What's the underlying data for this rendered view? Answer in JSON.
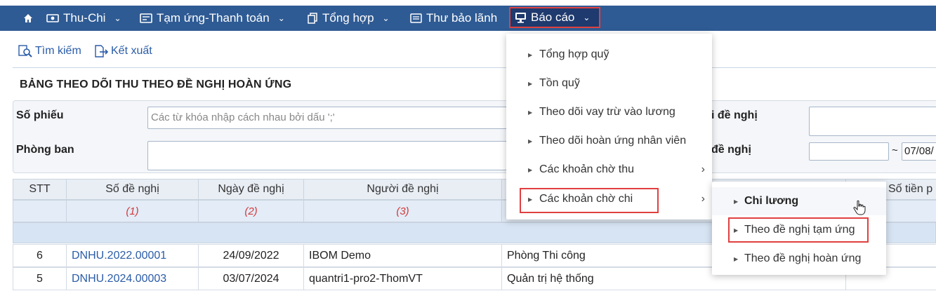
{
  "nav": {
    "items": [
      {
        "label": "Thu-Chi",
        "icon": "cash-icon"
      },
      {
        "label": "Tạm ứng-Thanh toán",
        "icon": "payment-icon"
      },
      {
        "label": "Tổng hợp",
        "icon": "copy-icon"
      },
      {
        "label": "Thư bảo lãnh",
        "icon": "letter-icon"
      },
      {
        "label": "Báo cáo",
        "icon": "monitor-icon"
      }
    ]
  },
  "toolbar": {
    "search_label": "Tìm kiếm",
    "export_label": "Kết xuất"
  },
  "page_title": "BẢNG THEO DÕI THU THEO ĐỀ NGHỊ HOÀN ỨNG",
  "filters": {
    "so_phieu_label": "Số phiếu",
    "so_phieu_placeholder": "Các từ khóa nhập cách nhau bởi dấu ';'",
    "phong_ban_label": "Phòng ban",
    "right_label_1": "i đề nghị",
    "right_label_2": "đề nghị",
    "date_sep": "~",
    "date_to": "07/08/"
  },
  "table": {
    "headers": [
      "STT",
      "Số đề nghị",
      "Ngày đề nghị",
      "Người đề nghị",
      "Số tiền p"
    ],
    "col_numbers": [
      "(1)",
      "(2)",
      "(3)"
    ],
    "rows": [
      {
        "stt": "6",
        "so": "DNHU.2022.00001",
        "ngay": "24/09/2022",
        "nguoi": "IBOM Demo",
        "phong": "Phòng Thi công"
      },
      {
        "stt": "5",
        "so": "DNHU.2024.00003",
        "ngay": "03/07/2024",
        "nguoi": "quantri1-pro2-ThomVT",
        "phong": "Quản trị hệ thống"
      }
    ]
  },
  "dropdown": {
    "items": [
      {
        "label": "Tổng hợp quỹ"
      },
      {
        "label": "Tồn quỹ"
      },
      {
        "label": "Theo dõi vay trừ vào lương"
      },
      {
        "label": "Theo dõi hoàn ứng nhân viên"
      },
      {
        "label": "Các khoản chờ thu",
        "arrow": "›"
      },
      {
        "label": "Các khoản chờ chi",
        "arrow": "›"
      }
    ]
  },
  "submenu": {
    "items": [
      {
        "label": "Chi lương"
      },
      {
        "label": "Theo đề nghị tạm ứng"
      },
      {
        "label": "Theo đề nghị hoàn ứng"
      }
    ]
  },
  "colors": {
    "nav_bg": "#2f5b94",
    "highlight": "#e04040",
    "link": "#2a5ca8"
  }
}
